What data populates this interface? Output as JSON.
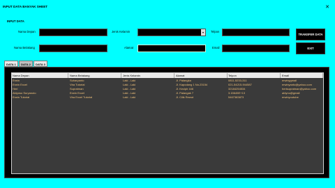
{
  "window": {
    "title": "INPUT DATA BANYAK SHEET",
    "close_glyph": "✕"
  },
  "form": {
    "group_title": "INPUT DATA",
    "labels": {
      "nama_depan": "Nama Depan",
      "nama_belakang": "Nama Belakang",
      "jenis_kelamin": "Jenis Kelamin",
      "alamat": "Alamat",
      "telpon": "Telpon",
      "email": "Email"
    },
    "values": {
      "nama_depan": "",
      "nama_belakang": "",
      "jenis_kelamin": "",
      "alamat": "",
      "telpon": "",
      "email": ""
    },
    "buttons": {
      "transfer": "TRANSFER DATA",
      "exit": "EXIT"
    }
  },
  "tabs": [
    "DATA 1",
    "DATA 2",
    "DATA 3"
  ],
  "active_tab": "DATA 2",
  "table": {
    "columns": [
      "Nama Depan",
      "Nama Belakang",
      "Jenis Kelamin",
      "Alamat",
      "Telpon",
      "Email"
    ],
    "rows": [
      [
        "Erwin",
        "Suharyanto",
        "Laki - Laki",
        "Jl. Palangka",
        "0811-5233-311",
        "erwinygmail"
      ],
      [
        "Erwin Excel",
        "Vba Tutorial",
        "Laki - Laki",
        "Jl. Kapodang 1 No.23154",
        "021-54215-944587",
        "erwinyanto@yahoo.com"
      ],
      [
        "Heri",
        "Supratman",
        "Laki - Laki",
        "Jl. Kecipir 446",
        "32184254534",
        "herisupratman@yahoo.com"
      ],
      [
        "Abiyoso Suryanoto",
        "Erwin Excel",
        "Laki - Laki",
        "Jl. Palangak 7",
        "3.15645E+13",
        "abiyno@gmail"
      ],
      [
        "Erwin Tutorial",
        "Vba Excel Tutorial",
        "Laki - Laki",
        "Jl. Cilik Rewut",
        "5467383873",
        "erwinyoutube"
      ]
    ]
  },
  "colors": {
    "background": "#00ffff",
    "cell_text": "#f2c27a",
    "grid_bg": "#3a3a3a"
  }
}
